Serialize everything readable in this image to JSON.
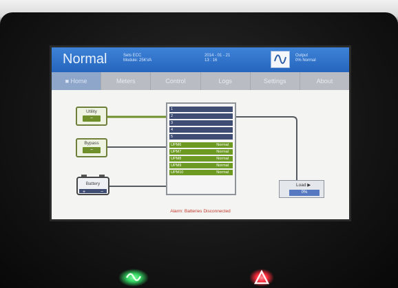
{
  "header": {
    "mode": "Normal",
    "info_line1": "Sets ECC",
    "info_line2": "Module: 25KVA",
    "date": "2014 - 01 - 21",
    "time": "13 : 16",
    "output_label": "Output",
    "output_line": "0%      Normal"
  },
  "tabs": [
    {
      "label": "■ Home"
    },
    {
      "label": "Meters"
    },
    {
      "label": "Control"
    },
    {
      "label": "Logs"
    },
    {
      "label": "Settings"
    },
    {
      "label": "About"
    }
  ],
  "sources": {
    "utility": "Utility",
    "bypass": "Bypass",
    "battery": "Battery"
  },
  "modules": [
    {
      "label": "1",
      "status": ""
    },
    {
      "label": "2",
      "status": ""
    },
    {
      "label": "3",
      "status": ""
    },
    {
      "label": "4",
      "status": ""
    },
    {
      "label": "5",
      "status": ""
    },
    {
      "label": "UPM6",
      "status": "Normal"
    },
    {
      "label": "UPM7",
      "status": "Normal"
    },
    {
      "label": "UPM8",
      "status": "Normal"
    },
    {
      "label": "UPM9",
      "status": "Normal"
    },
    {
      "label": "UPM10",
      "status": "Normal"
    }
  ],
  "load": {
    "label": "Load ▶",
    "value": "0%"
  },
  "alarm": "Alarm: Batteries Disconnected",
  "colors": {
    "header_blue": "#2665bd",
    "module_ok": "#6c9a22",
    "module_empty": "#3f4d74",
    "alarm_red": "#c0352a",
    "led_green": "#32d060",
    "led_red": "#ff2b3b"
  }
}
